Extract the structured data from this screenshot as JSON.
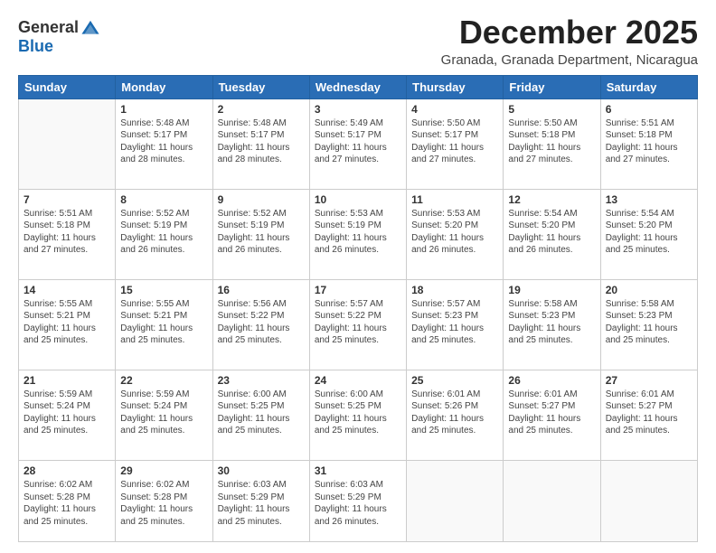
{
  "header": {
    "logo_general": "General",
    "logo_blue": "Blue",
    "month_title": "December 2025",
    "subtitle": "Granada, Granada Department, Nicaragua"
  },
  "weekdays": [
    "Sunday",
    "Monday",
    "Tuesday",
    "Wednesday",
    "Thursday",
    "Friday",
    "Saturday"
  ],
  "weeks": [
    [
      {
        "day": "",
        "info": ""
      },
      {
        "day": "1",
        "info": "Sunrise: 5:48 AM\nSunset: 5:17 PM\nDaylight: 11 hours\nand 28 minutes."
      },
      {
        "day": "2",
        "info": "Sunrise: 5:48 AM\nSunset: 5:17 PM\nDaylight: 11 hours\nand 28 minutes."
      },
      {
        "day": "3",
        "info": "Sunrise: 5:49 AM\nSunset: 5:17 PM\nDaylight: 11 hours\nand 27 minutes."
      },
      {
        "day": "4",
        "info": "Sunrise: 5:50 AM\nSunset: 5:17 PM\nDaylight: 11 hours\nand 27 minutes."
      },
      {
        "day": "5",
        "info": "Sunrise: 5:50 AM\nSunset: 5:18 PM\nDaylight: 11 hours\nand 27 minutes."
      },
      {
        "day": "6",
        "info": "Sunrise: 5:51 AM\nSunset: 5:18 PM\nDaylight: 11 hours\nand 27 minutes."
      }
    ],
    [
      {
        "day": "7",
        "info": "Sunrise: 5:51 AM\nSunset: 5:18 PM\nDaylight: 11 hours\nand 27 minutes."
      },
      {
        "day": "8",
        "info": "Sunrise: 5:52 AM\nSunset: 5:19 PM\nDaylight: 11 hours\nand 26 minutes."
      },
      {
        "day": "9",
        "info": "Sunrise: 5:52 AM\nSunset: 5:19 PM\nDaylight: 11 hours\nand 26 minutes."
      },
      {
        "day": "10",
        "info": "Sunrise: 5:53 AM\nSunset: 5:19 PM\nDaylight: 11 hours\nand 26 minutes."
      },
      {
        "day": "11",
        "info": "Sunrise: 5:53 AM\nSunset: 5:20 PM\nDaylight: 11 hours\nand 26 minutes."
      },
      {
        "day": "12",
        "info": "Sunrise: 5:54 AM\nSunset: 5:20 PM\nDaylight: 11 hours\nand 26 minutes."
      },
      {
        "day": "13",
        "info": "Sunrise: 5:54 AM\nSunset: 5:20 PM\nDaylight: 11 hours\nand 25 minutes."
      }
    ],
    [
      {
        "day": "14",
        "info": "Sunrise: 5:55 AM\nSunset: 5:21 PM\nDaylight: 11 hours\nand 25 minutes."
      },
      {
        "day": "15",
        "info": "Sunrise: 5:55 AM\nSunset: 5:21 PM\nDaylight: 11 hours\nand 25 minutes."
      },
      {
        "day": "16",
        "info": "Sunrise: 5:56 AM\nSunset: 5:22 PM\nDaylight: 11 hours\nand 25 minutes."
      },
      {
        "day": "17",
        "info": "Sunrise: 5:57 AM\nSunset: 5:22 PM\nDaylight: 11 hours\nand 25 minutes."
      },
      {
        "day": "18",
        "info": "Sunrise: 5:57 AM\nSunset: 5:23 PM\nDaylight: 11 hours\nand 25 minutes."
      },
      {
        "day": "19",
        "info": "Sunrise: 5:58 AM\nSunset: 5:23 PM\nDaylight: 11 hours\nand 25 minutes."
      },
      {
        "day": "20",
        "info": "Sunrise: 5:58 AM\nSunset: 5:23 PM\nDaylight: 11 hours\nand 25 minutes."
      }
    ],
    [
      {
        "day": "21",
        "info": "Sunrise: 5:59 AM\nSunset: 5:24 PM\nDaylight: 11 hours\nand 25 minutes."
      },
      {
        "day": "22",
        "info": "Sunrise: 5:59 AM\nSunset: 5:24 PM\nDaylight: 11 hours\nand 25 minutes."
      },
      {
        "day": "23",
        "info": "Sunrise: 6:00 AM\nSunset: 5:25 PM\nDaylight: 11 hours\nand 25 minutes."
      },
      {
        "day": "24",
        "info": "Sunrise: 6:00 AM\nSunset: 5:25 PM\nDaylight: 11 hours\nand 25 minutes."
      },
      {
        "day": "25",
        "info": "Sunrise: 6:01 AM\nSunset: 5:26 PM\nDaylight: 11 hours\nand 25 minutes."
      },
      {
        "day": "26",
        "info": "Sunrise: 6:01 AM\nSunset: 5:27 PM\nDaylight: 11 hours\nand 25 minutes."
      },
      {
        "day": "27",
        "info": "Sunrise: 6:01 AM\nSunset: 5:27 PM\nDaylight: 11 hours\nand 25 minutes."
      }
    ],
    [
      {
        "day": "28",
        "info": "Sunrise: 6:02 AM\nSunset: 5:28 PM\nDaylight: 11 hours\nand 25 minutes."
      },
      {
        "day": "29",
        "info": "Sunrise: 6:02 AM\nSunset: 5:28 PM\nDaylight: 11 hours\nand 25 minutes."
      },
      {
        "day": "30",
        "info": "Sunrise: 6:03 AM\nSunset: 5:29 PM\nDaylight: 11 hours\nand 25 minutes."
      },
      {
        "day": "31",
        "info": "Sunrise: 6:03 AM\nSunset: 5:29 PM\nDaylight: 11 hours\nand 26 minutes."
      },
      {
        "day": "",
        "info": ""
      },
      {
        "day": "",
        "info": ""
      },
      {
        "day": "",
        "info": ""
      }
    ]
  ]
}
